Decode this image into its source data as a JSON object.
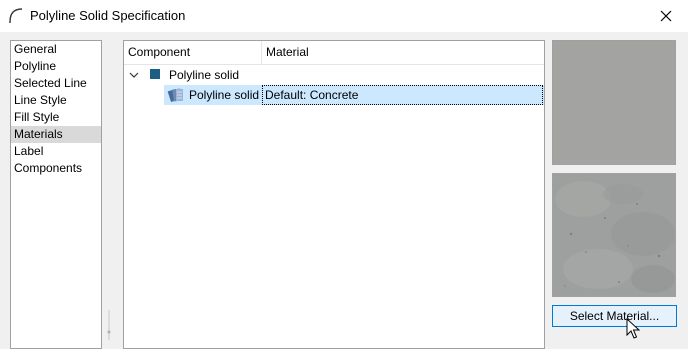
{
  "window": {
    "title": "Polyline Solid Specification",
    "title_icon": "arc-icon",
    "close_icon": "close-icon"
  },
  "nav": {
    "items": [
      {
        "label": "General",
        "selected": false
      },
      {
        "label": "Polyline",
        "selected": false
      },
      {
        "label": "Selected Line",
        "selected": false
      },
      {
        "label": "Line Style",
        "selected": false
      },
      {
        "label": "Fill Style",
        "selected": false
      },
      {
        "label": "Materials",
        "selected": true
      },
      {
        "label": "Label",
        "selected": false
      },
      {
        "label": "Components",
        "selected": false
      }
    ]
  },
  "materials_tree": {
    "columns": [
      "Component",
      "Material"
    ],
    "parent": {
      "label": "Polyline solid",
      "expanded": true,
      "swatch_color": "#1c5e84"
    },
    "child": {
      "label": "Polyline solid",
      "material": "Default: Concrete",
      "icon": "material-layers-icon",
      "selected": true
    }
  },
  "preview": {
    "flat_color": "#a3a3a1",
    "texture": "concrete"
  },
  "actions": {
    "select_material_label": "Select Material..."
  },
  "colors": {
    "selection": "#cce8ff",
    "nav_selected": "#d9d9d9",
    "button_border": "#0078d7",
    "button_bg": "#e5f1fb"
  }
}
